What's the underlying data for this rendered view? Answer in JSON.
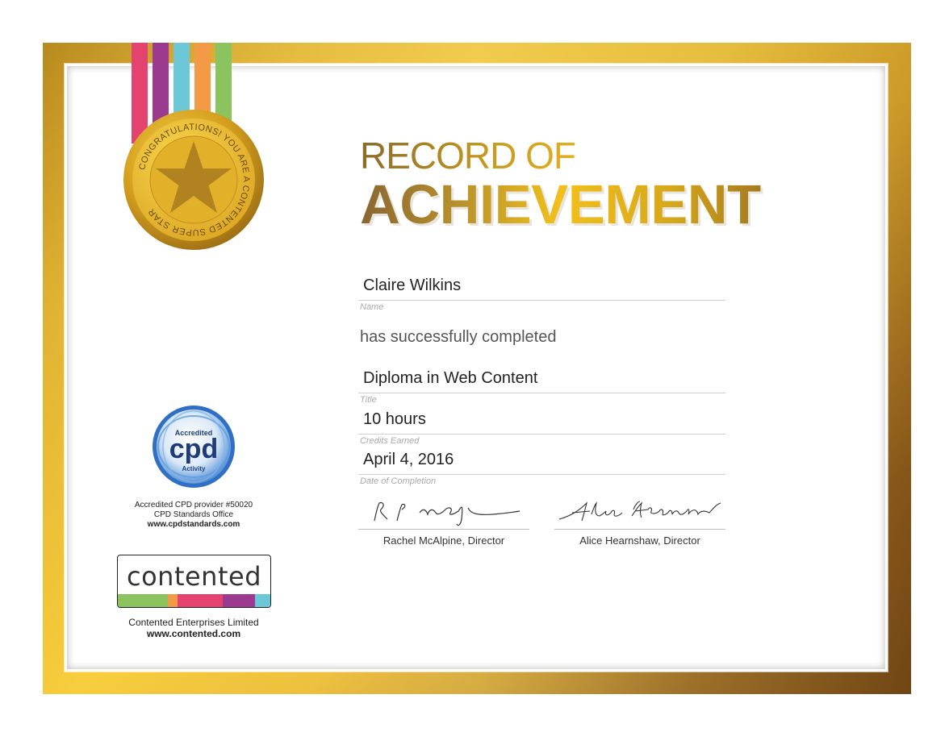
{
  "title": {
    "line1": "RECORD OF",
    "line2": "ACHIEVEMENT"
  },
  "medal": {
    "text": "CONGRATULATIONS! YOU ARE A CONTENTED SUPER STAR",
    "icon": "star-icon"
  },
  "ribbon_colors": [
    "#e5436f",
    "#9b3a8f",
    "#6cc7d6",
    "#f29a45",
    "#8bc35f"
  ],
  "fields": {
    "name": {
      "value": "Claire Wilkins",
      "caption": "Name"
    },
    "completed_text": "has successfully completed",
    "title": {
      "value": "Diploma in Web Content",
      "caption": "Title"
    },
    "credits": {
      "value": "10 hours",
      "caption": "Credits Earned"
    },
    "date": {
      "value": "April 4, 2016",
      "caption": "Date of Completion"
    }
  },
  "signatures": [
    {
      "name": "Rachel McAlpine, Director"
    },
    {
      "name": "Alice Hearnshaw, Director"
    }
  ],
  "cpd": {
    "badge_top": "Accredited",
    "badge_main": "cpd",
    "badge_bottom": "Activity",
    "line1": "Accredited CPD provider #50020",
    "line2": "CPD Standards Office",
    "line3": "www.cpdstandards.com"
  },
  "logo": {
    "word": "contented",
    "bar_colors": [
      "#8bc35f",
      "#f29a45",
      "#e5436f",
      "#9b3a8f",
      "#6cc7d6"
    ]
  },
  "company": {
    "name": "Contented Enterprises Limited",
    "url": "www.contented.com"
  }
}
